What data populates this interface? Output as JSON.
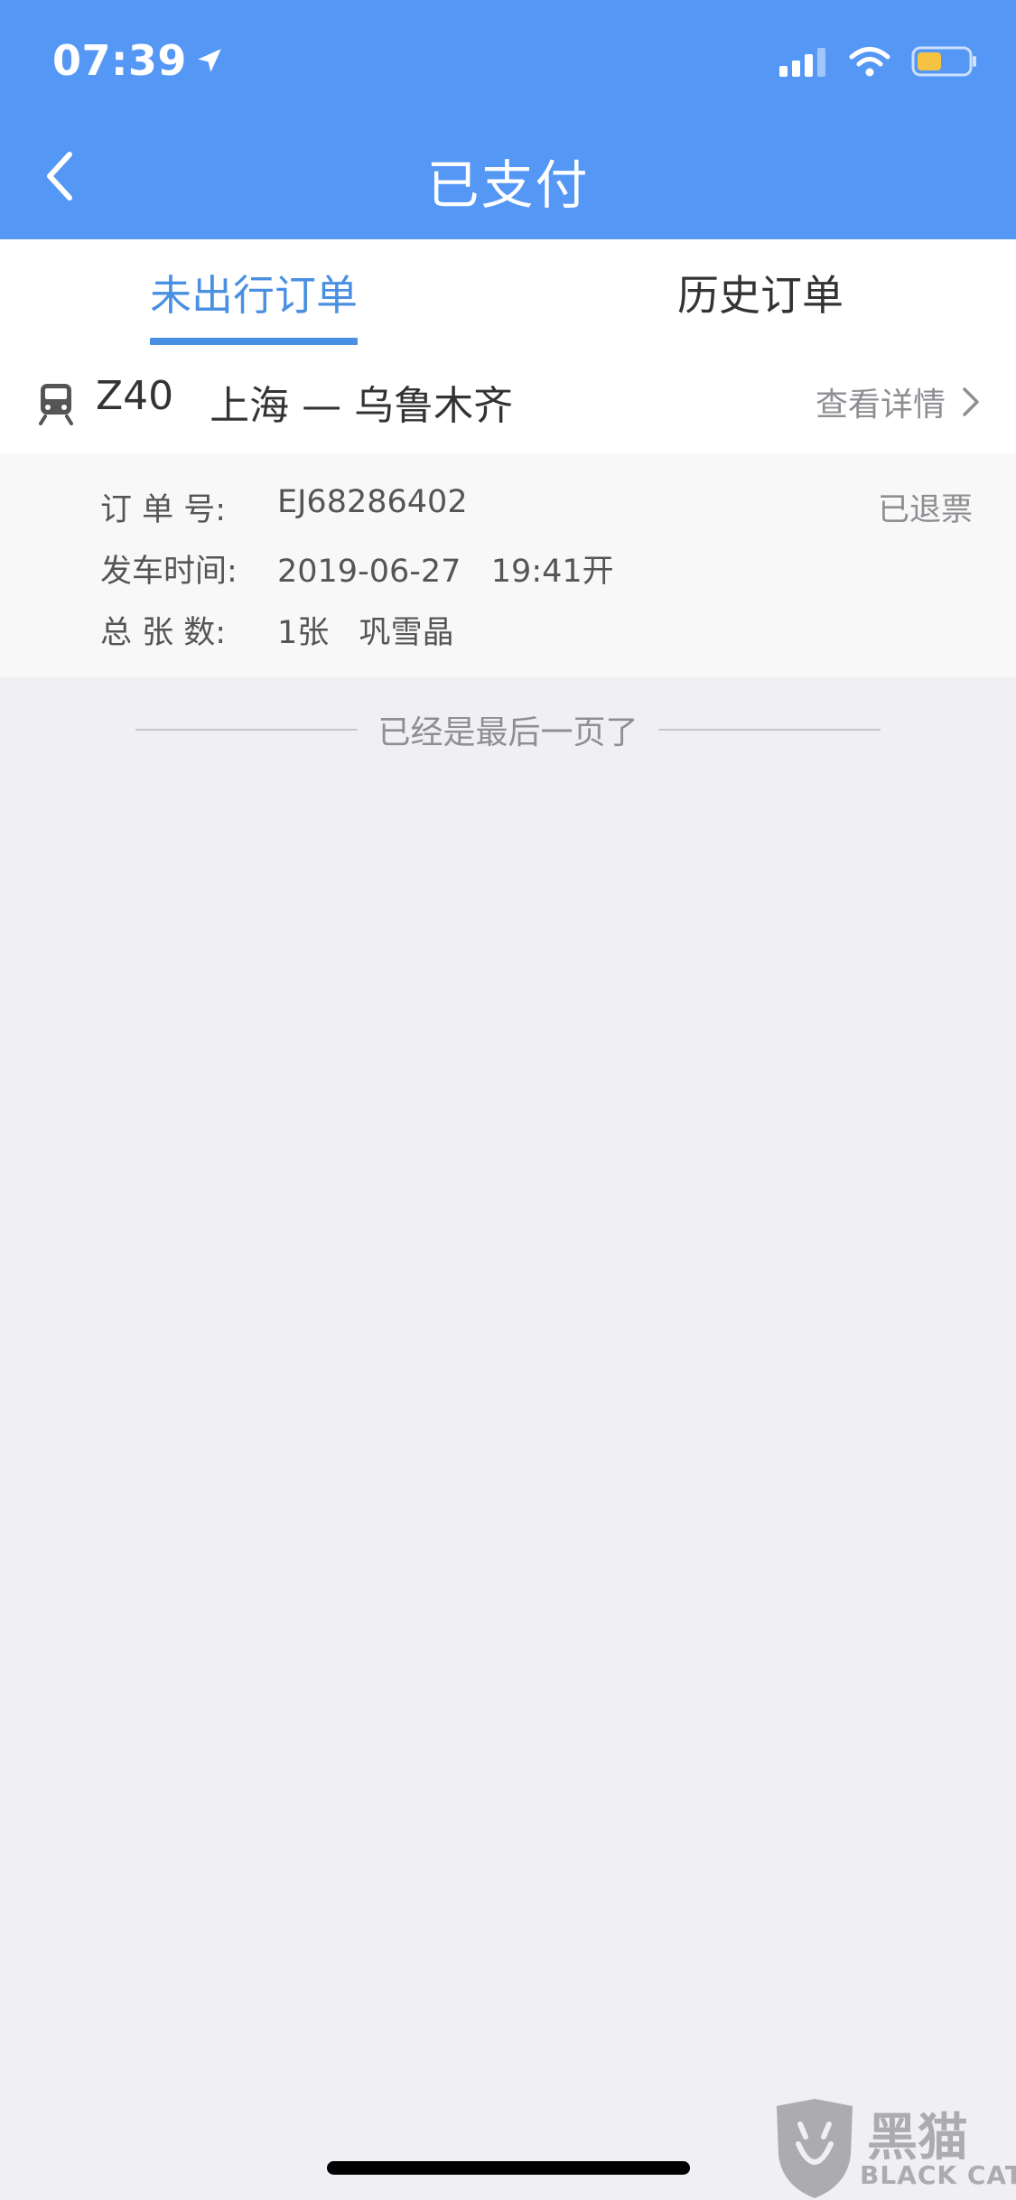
{
  "status_bar": {
    "time": "07:39"
  },
  "nav": {
    "title": "已支付"
  },
  "tabs": [
    {
      "label": "未出行订单",
      "active": true
    },
    {
      "label": "历史订单",
      "active": false
    }
  ],
  "order": {
    "train_no": "Z40",
    "route": "上海 — 乌鲁木齐",
    "detail_label": "查看详情",
    "status": "已退票",
    "rows": [
      {
        "label": "订 单 号:",
        "value": "EJ68286402"
      },
      {
        "label": "发车时间:",
        "value": "2019-06-27   19:41开"
      },
      {
        "label": "总 张 数:",
        "value": "1张   巩雪晶"
      }
    ]
  },
  "end_note": "已经是最后一页了",
  "watermark": {
    "cn": "黑猫",
    "en": "BLACK CAT"
  },
  "colors": {
    "header": "#5597f5",
    "accent": "#4a90e2",
    "battery": "#f5c342"
  }
}
